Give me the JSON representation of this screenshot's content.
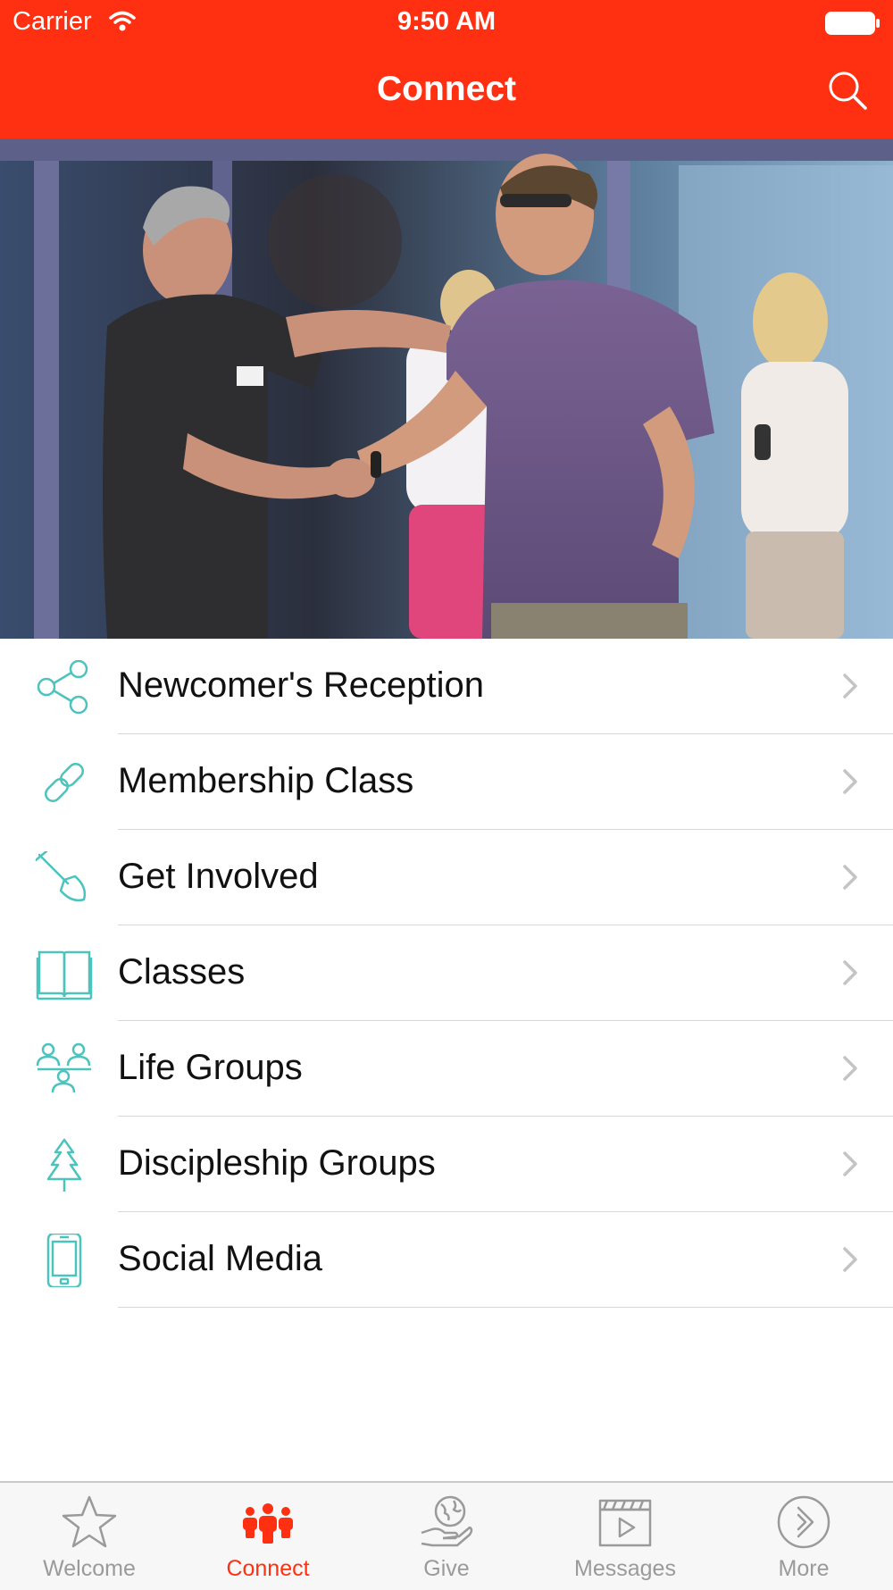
{
  "status_bar": {
    "carrier": "Carrier",
    "time": "9:50 AM"
  },
  "nav": {
    "title": "Connect",
    "search_icon": "search-icon"
  },
  "hero": {
    "description_icon": "photo"
  },
  "menu": [
    {
      "label": "Newcomer's Reception",
      "icon": "share-icon"
    },
    {
      "label": "Membership Class",
      "icon": "link-icon"
    },
    {
      "label": "Get Involved",
      "icon": "shovel-icon"
    },
    {
      "label": "Classes",
      "icon": "book-icon"
    },
    {
      "label": "Life Groups",
      "icon": "people-group-icon"
    },
    {
      "label": "Discipleship Groups",
      "icon": "tree-icon"
    },
    {
      "label": "Social Media",
      "icon": "phone-icon"
    }
  ],
  "tabs": [
    {
      "label": "Welcome",
      "icon": "star-icon",
      "active": false
    },
    {
      "label": "Connect",
      "icon": "people-icon",
      "active": true
    },
    {
      "label": "Give",
      "icon": "giving-hand-icon",
      "active": false
    },
    {
      "label": "Messages",
      "icon": "clapperboard-icon",
      "active": false
    },
    {
      "label": "More",
      "icon": "more-circle-icon",
      "active": false
    }
  ],
  "colors": {
    "brand": "#ff3011",
    "icon_teal": "#4cc3bd",
    "chevron": "#c4c4c4",
    "tab_inactive": "#9a9a9a"
  }
}
